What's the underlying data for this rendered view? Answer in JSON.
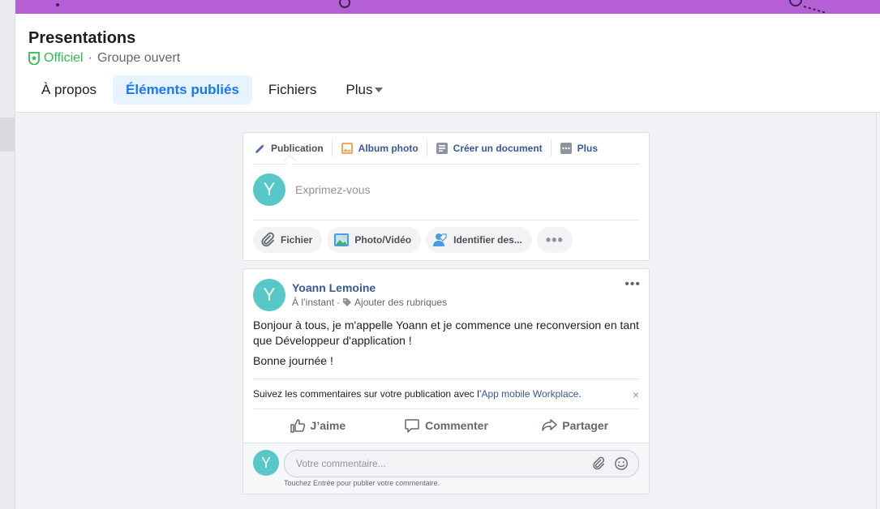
{
  "group": {
    "title": "Presentations",
    "official": "Officiel",
    "separator": "·",
    "type": "Groupe ouvert"
  },
  "tabs": [
    {
      "label": "À propos"
    },
    {
      "label": "Éléments publiés",
      "active": true
    },
    {
      "label": "Fichiers"
    },
    {
      "label": "Plus"
    }
  ],
  "composer": {
    "tabs": [
      {
        "label": "Publication",
        "icon": "pencil-icon"
      },
      {
        "label": "Album photo",
        "icon": "photo-album-icon"
      },
      {
        "label": "Créer un document",
        "icon": "document-icon"
      },
      {
        "label": "Plus",
        "icon": "more-icon"
      }
    ],
    "avatar_letter": "Y",
    "placeholder": "Exprimez-vous",
    "pills": [
      {
        "label": "Fichier",
        "icon": "paperclip-icon"
      },
      {
        "label": "Photo/Vidéo",
        "icon": "photo-icon"
      },
      {
        "label": "Identifier des...",
        "icon": "tag-people-icon"
      }
    ],
    "more_pill": "•••"
  },
  "post": {
    "avatar_letter": "Y",
    "author": "Yoann Lemoine",
    "time": "À l’instant",
    "sub_separator": "·",
    "add_topics": "Ajouter des rubriques",
    "menu": "•••",
    "paragraphs": [
      "Bonjour à tous, je m'appelle Yoann et je commence une reconversion en tant que Développeur d'application !",
      "Bonne journée !"
    ],
    "notice_prefix": "Suivez les commentaires sur votre publication avec l’",
    "notice_link": "App mobile Workplace",
    "notice_suffix": ".",
    "notice_close": "×",
    "actions": [
      {
        "label": "J’aime",
        "icon": "like-icon"
      },
      {
        "label": "Commenter",
        "icon": "comment-icon"
      },
      {
        "label": "Partager",
        "icon": "share-icon"
      }
    ],
    "comment": {
      "avatar_letter": "Y",
      "placeholder": "Votre commentaire...",
      "hint": "Touchez Entrée pour publier votre commentaire."
    }
  },
  "colors": {
    "cover": "#b55fd6",
    "accent": "#1877f2",
    "official": "#2ebc4f",
    "avatar": "#57c7c7",
    "link": "#385898"
  }
}
